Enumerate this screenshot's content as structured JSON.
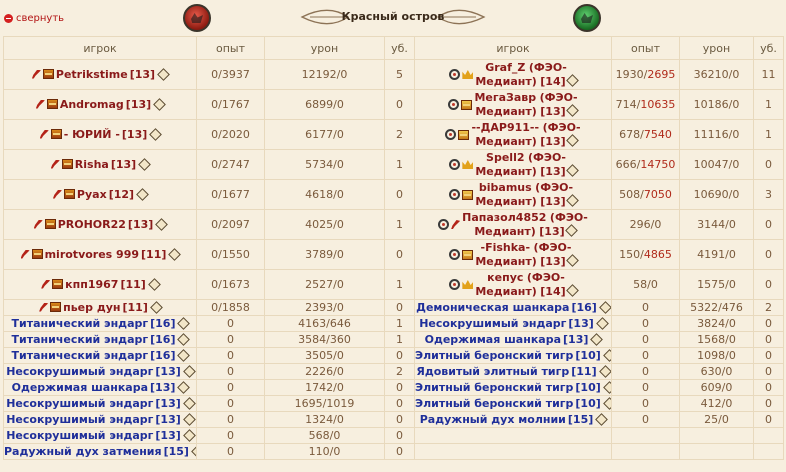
{
  "header": {
    "collapse_label": "свернуть",
    "title": "Красный остров"
  },
  "columns": {
    "player": "игрок",
    "exp": "опыт",
    "damage": "урон",
    "kills": "уб."
  },
  "left": [
    {
      "name": "Petrikstime",
      "level": "[13]",
      "exp": "0/3937",
      "damage": "12192/0",
      "kills": "5"
    },
    {
      "name": "Andromag",
      "level": "[13]",
      "exp": "0/1767",
      "damage": "6899/0",
      "kills": "0"
    },
    {
      "name": "- ЮРИЙ -",
      "level": "[13]",
      "exp": "0/2020",
      "damage": "6177/0",
      "kills": "2"
    },
    {
      "name": "Risha",
      "level": "[13]",
      "exp": "0/2747",
      "damage": "5734/0",
      "kills": "1"
    },
    {
      "name": "Руах",
      "level": "[12]",
      "exp": "0/1677",
      "damage": "4618/0",
      "kills": "0"
    },
    {
      "name": "PROHOR22",
      "level": "[13]",
      "exp": "0/2097",
      "damage": "4025/0",
      "kills": "1"
    },
    {
      "name": "mirotvores 999",
      "level": "[11]",
      "exp": "0/1550",
      "damage": "3789/0",
      "kills": "0"
    },
    {
      "name": "кпп1967",
      "level": "[11]",
      "exp": "0/1673",
      "damage": "2527/0",
      "kills": "1"
    },
    {
      "name": "пьер дун",
      "level": "[11]",
      "exp": "0/1858",
      "damage": "2393/0",
      "kills": "0"
    },
    {
      "name": "Титанический эндарг",
      "level": "[16]",
      "exp": "0",
      "damage": "4163/646",
      "kills": "1"
    },
    {
      "name": "Титанический эндарг",
      "level": "[16]",
      "exp": "0",
      "damage": "3584/360",
      "kills": "1"
    },
    {
      "name": "Титанический эндарг",
      "level": "[16]",
      "exp": "0",
      "damage": "3505/0",
      "kills": "0"
    },
    {
      "name": "Несокрушимый эндарг",
      "level": "[13]",
      "exp": "0",
      "damage": "2226/0",
      "kills": "2"
    },
    {
      "name": "Одержимая шанкара",
      "level": "[13]",
      "exp": "0",
      "damage": "1742/0",
      "kills": "0"
    },
    {
      "name": "Несокрушимый эндарг",
      "level": "[13]",
      "exp": "0",
      "damage": "1695/1019",
      "kills": "0"
    },
    {
      "name": "Несокрушимый эндарг",
      "level": "[13]",
      "exp": "0",
      "damage": "1324/0",
      "kills": "0"
    },
    {
      "name": "Несокрушимый эндарг",
      "level": "[13]",
      "exp": "0",
      "damage": "568/0",
      "kills": "0"
    },
    {
      "name": "Радужный дух затмения",
      "level": "[15]",
      "exp": "0",
      "damage": "110/0",
      "kills": "0"
    }
  ],
  "right": [
    {
      "name": "Graf_Z",
      "clan": "(ФЭО-",
      "clan2": "Медиант)",
      "level": "[14]",
      "exp_a": "1930/",
      "exp_b": "2695",
      "damage": "36210/0",
      "kills": "11"
    },
    {
      "name": "МегаЗавр",
      "clan": "(ФЭО-",
      "clan2": "Медиант)",
      "level": "[13]",
      "exp_a": "714/",
      "exp_b": "10635",
      "damage": "10186/0",
      "kills": "1"
    },
    {
      "name": "--ДАР911--",
      "clan": "(ФЭО-",
      "clan2": "Медиант)",
      "level": "[13]",
      "exp_a": "678/",
      "exp_b": "7540",
      "damage": "11116/0",
      "kills": "1"
    },
    {
      "name": "Spell2",
      "clan": "(ФЭО-",
      "clan2": "Медиант)",
      "level": "[13]",
      "exp_a": "666/",
      "exp_b": "14750",
      "damage": "10047/0",
      "kills": "0"
    },
    {
      "name": "bibamus",
      "clan": "(ФЭО-",
      "clan2": "Медиант)",
      "level": "[13]",
      "exp_a": "508/",
      "exp_b": "7050",
      "damage": "10690/0",
      "kills": "3"
    },
    {
      "name": "Папазол4852",
      "clan": "(ФЭО-",
      "clan2": "Медиант)",
      "level": "[13]",
      "exp_a": "296/0",
      "exp_b": "",
      "damage": "3144/0",
      "kills": "0"
    },
    {
      "name": "-Fishka-",
      "clan": "(ФЭО-",
      "clan2": "Медиант)",
      "level": "[13]",
      "exp_a": "150/",
      "exp_b": "4865",
      "damage": "4191/0",
      "kills": "0"
    },
    {
      "name": "кепус",
      "clan": "(ФЭО-",
      "clan2": "Медиант)",
      "level": "[14]",
      "exp_a": "58/0",
      "exp_b": "",
      "damage": "1575/0",
      "kills": "0"
    },
    {
      "name": "Демоническая шанкара",
      "level": "[16]",
      "exp": "0",
      "damage": "5322/476",
      "kills": "2"
    },
    {
      "name": "Несокрушимый эндарг",
      "level": "[13]",
      "exp": "0",
      "damage": "3824/0",
      "kills": "0"
    },
    {
      "name": "Одержимая шанкара",
      "level": "[13]",
      "exp": "0",
      "damage": "1568/0",
      "kills": "0"
    },
    {
      "name": "Элитный беронский тигр",
      "level": "[10]",
      "exp": "0",
      "damage": "1098/0",
      "kills": "0"
    },
    {
      "name": "Ядовитый элитный тигр",
      "level": "[11]",
      "exp": "0",
      "damage": "630/0",
      "kills": "0"
    },
    {
      "name": "Элитный беронский тигр",
      "level": "[10]",
      "exp": "0",
      "damage": "609/0",
      "kills": "0"
    },
    {
      "name": "Элитный беронский тигр",
      "level": "[10]",
      "exp": "0",
      "damage": "412/0",
      "kills": "0"
    },
    {
      "name": "Радужный дух молнии",
      "level": "[15]",
      "exp": "0",
      "damage": "25/0",
      "kills": "0"
    }
  ],
  "colors": {
    "background": "#f7efdf",
    "player_name": "#8a1a1a",
    "bot_name": "#1f2f9a",
    "numbers": "#7a5a3c",
    "exp_max": "#b02a1a"
  },
  "icons": [
    "sword-icon",
    "rank-icon",
    "target-icon",
    "crown-icon",
    "info-icon",
    "collapse-icon"
  ]
}
